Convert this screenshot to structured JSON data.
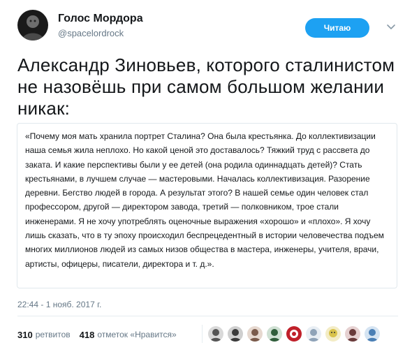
{
  "author": {
    "name": "Голос Мордора",
    "handle": "@spacelordrock",
    "avatar_icon": "dark-portrait-avatar"
  },
  "follow_button": {
    "label": "Читаю",
    "color": "#1da1f2"
  },
  "more_icon": "chevron-down-icon",
  "tweet": {
    "text": "Александр Зиновьев, которого сталинистом не назовёшь при самом большом желании никак:"
  },
  "quote": {
    "text": "«Почему моя мать хранила портрет Сталина? Она была крестьянка. До коллективизации наша семья жила неплохо. Но какой ценой это доставалось? Тяжкий труд с рассвета до заката. И какие перспективы были у ее детей (она родила одиннадцать детей)? Стать крестьянами, в лучшем случае — мастеровыми. Началась коллективизация. Разорение деревни. Бегство людей в города. А результат этого? В нашей семье один человек стал профессором, другой — директором завода, третий — полковником, трое стали инженерами. Я не хочу употреблять оценочные выражения «хорошо» и «плохо». Я хочу лишь сказать, что в ту эпоху происходил беспрецедентный в истории человечества подъем многих миллионов людей из самых низов общества в мастера, инженеры, учителя, врачи, артисты, офицеры, писатели, директора и т. д.»."
  },
  "timestamp": "22:44 - 1 нояб. 2017 г.",
  "stats": {
    "retweets_count": "310",
    "retweets_label": "ретвитов",
    "likes_count": "418",
    "likes_label": "отметок «Нравится»"
  },
  "likers": [
    {
      "icon": "liker-avatar-1",
      "color": "#555555"
    },
    {
      "icon": "liker-avatar-2",
      "color": "#3a3a3a"
    },
    {
      "icon": "liker-avatar-3",
      "color": "#7a5a4a"
    },
    {
      "icon": "liker-avatar-4",
      "color": "#2f5d3a"
    },
    {
      "icon": "liker-avatar-5",
      "color": "#c0202a"
    },
    {
      "icon": "liker-avatar-6",
      "color": "#8fa3b8"
    },
    {
      "icon": "liker-avatar-7",
      "color": "#d8c24a"
    },
    {
      "icon": "liker-avatar-8",
      "color": "#6a3b3b"
    },
    {
      "icon": "liker-avatar-9",
      "color": "#4a7fb5"
    }
  ]
}
